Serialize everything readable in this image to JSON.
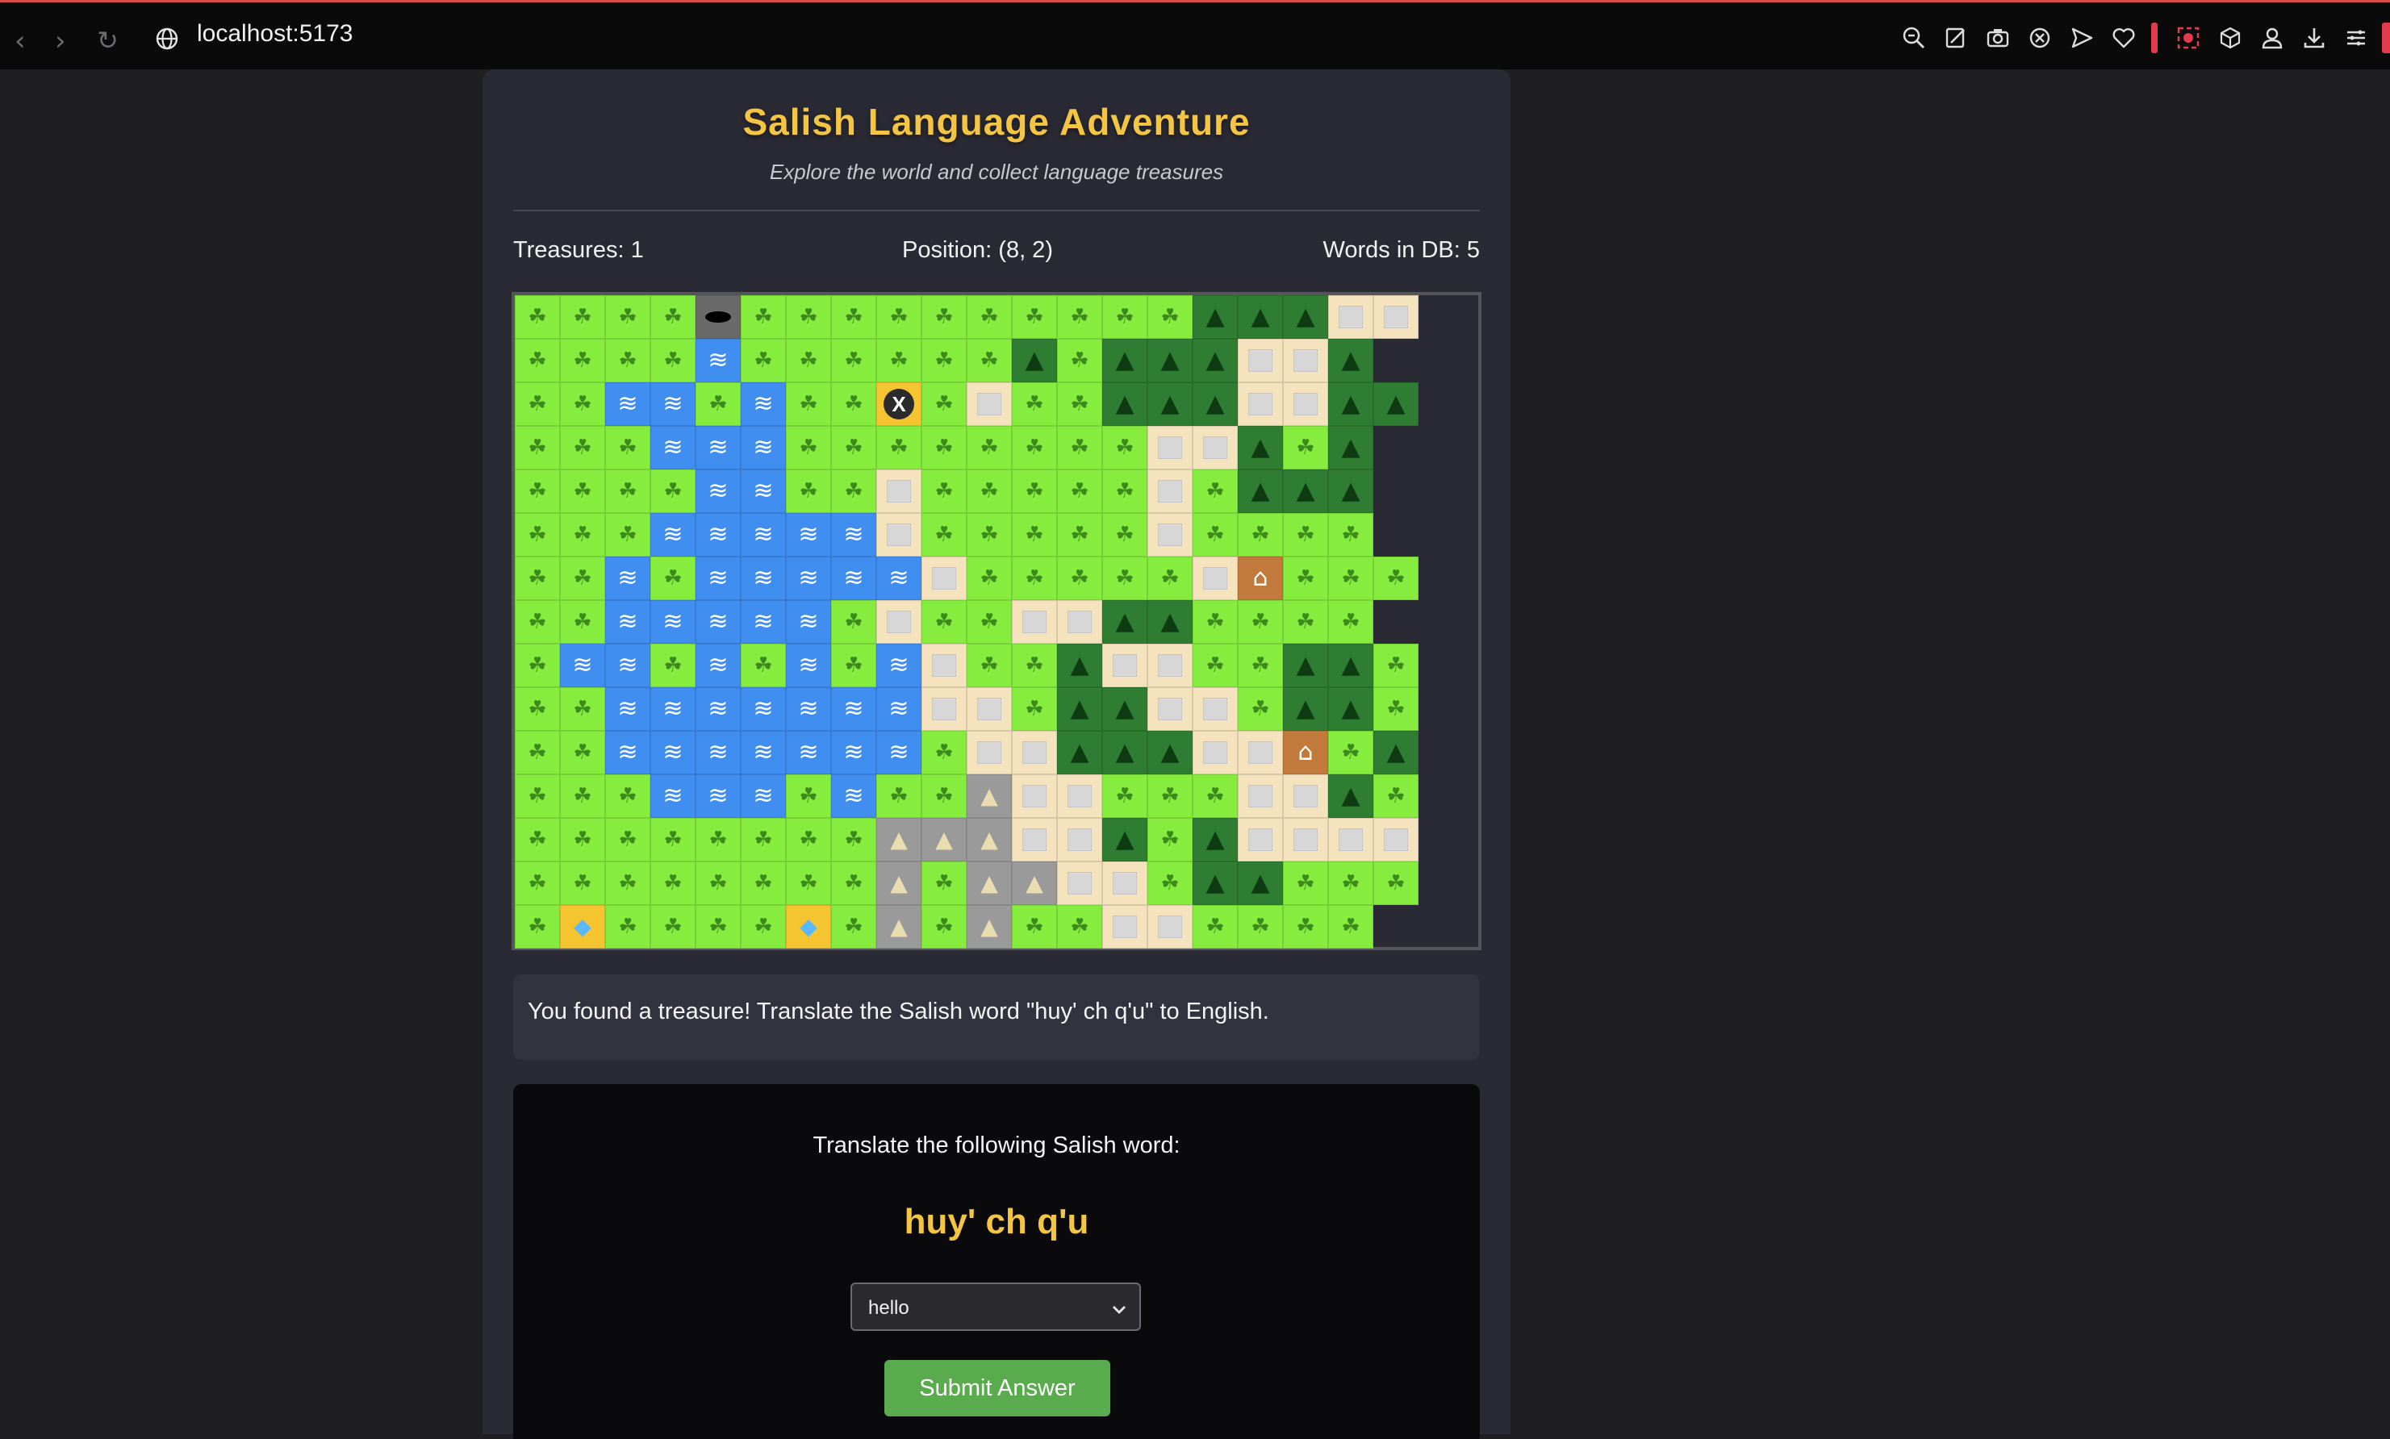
{
  "browser": {
    "url": "localhost:5173",
    "toolbar_icons": [
      "zoom-out-icon",
      "edit-icon",
      "camera-icon",
      "shield-icon",
      "send-icon",
      "heart-icon",
      "record-icon",
      "cube-icon",
      "profile-icon",
      "download-icon",
      "menu-icon"
    ],
    "accent_color": "#e23b4b"
  },
  "app": {
    "title": "Salish Language Adventure",
    "subtitle": "Explore the world and collect language treasures",
    "stats": {
      "treasures": "Treasures: 1",
      "position": "Position: (8, 2)",
      "words": "Words in DB: 5"
    },
    "title_color": "#f4c542"
  },
  "map": {
    "legend": {
      "G": "grass",
      "F": "forest",
      "W": "water",
      "S": "sand",
      "M": "mountain",
      "C": "cave",
      "T": "treasure",
      "H": "house",
      "P": "player"
    },
    "player_label": "X",
    "rows": [
      "GGGGCGGGGGGGGGGFFFSS",
      "GGGGWGGGGGGFGFFFSSF",
      "GGWWGWGGPGSGGFFFSSFF",
      "GGGWWWGGGGGGGGSSFGF",
      "GGGGWWGGSGGGGGSGFFF",
      "GGGWWWWWSGGGGGSGGGG",
      "GGWGWWWWWSGGGGGSHGGGG",
      "GGWWWWWGSGGSSFFGGGG",
      "GWWGWGWGWSGGFSSGGFFG",
      "GGWWWWWWWSSGFFSSGFFG",
      "GGWWWWWWWGSSFFFSSHGF",
      "GGGWWWGWGGMSSGGGSSFG",
      "GGGGGGGGMMMSSFGFSSSS",
      "GGGGGGGGMGMMSSGFFGGG",
      "GTGGGGTGMGMGGSSGGGG"
    ]
  },
  "message": {
    "text": "You found a treasure! Translate the Salish word \"huy' ch q'u\" to English."
  },
  "quiz": {
    "prompt": "Translate the following Salish word:",
    "word": "huy' ch q'u",
    "selected_option": "hello",
    "submit_label": "Submit Answer",
    "submit_color": "#5aab4d"
  }
}
